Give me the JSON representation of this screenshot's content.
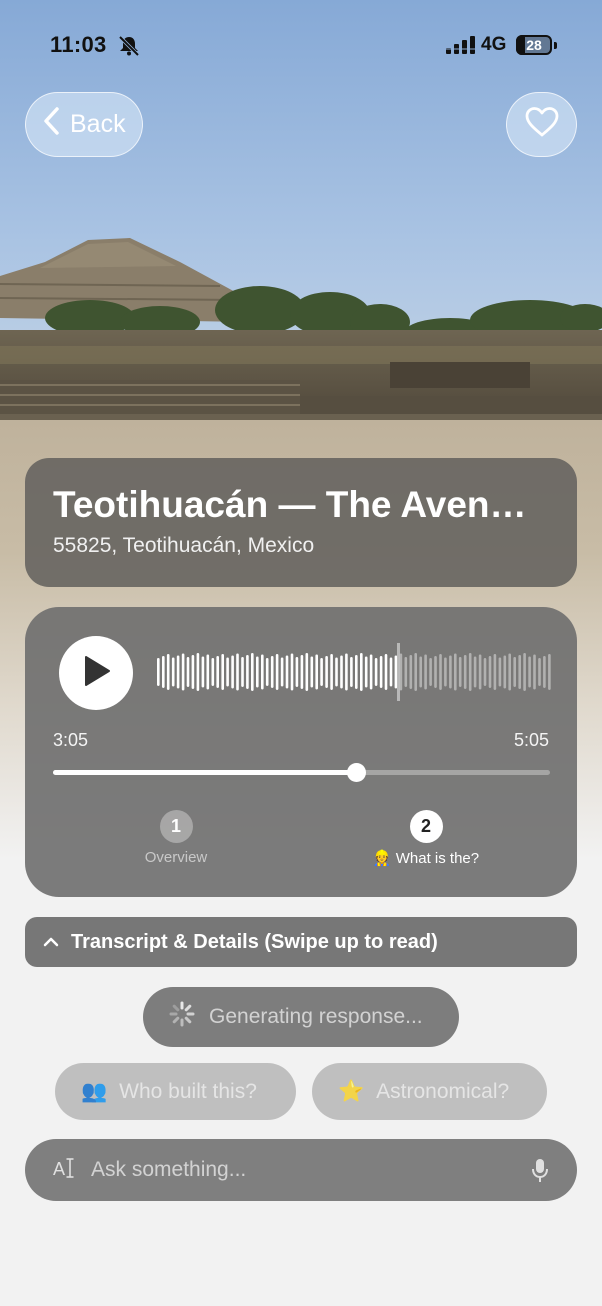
{
  "status_bar": {
    "time": "11:03",
    "network": "4G",
    "battery": "28",
    "icons": [
      "bell-slash-icon",
      "signal-icon",
      "battery-icon"
    ]
  },
  "nav": {
    "back_label": "Back",
    "back_icon": "chevron-left-icon",
    "favorite_icon": "heart-icon"
  },
  "place": {
    "title": "Teotihuacán — The Aven…",
    "address": "55825, Teotihuacán, Mexico"
  },
  "player": {
    "play_icon": "play-icon",
    "current_time": "3:05",
    "total_time": "5:05",
    "progress": 0.61,
    "chapters": [
      {
        "number": "1",
        "label": "Overview",
        "active": false
      },
      {
        "number": "2",
        "emoji": "👷",
        "label": "What is the?",
        "active": true
      }
    ]
  },
  "transcript": {
    "label": "Transcript & Details (Swipe up to read)",
    "icon": "chevron-up-icon"
  },
  "generating": {
    "label": "Generating response...",
    "icon": "spinner-icon"
  },
  "suggestions": [
    {
      "emoji": "👥",
      "label": "Who built this?"
    },
    {
      "emoji": "⭐",
      "label": "Astronomical?"
    }
  ],
  "ask": {
    "placeholder": "Ask something...",
    "icons": [
      "text-cursor-icon",
      "microphone-icon"
    ]
  },
  "colors": {
    "card_gray": "#646260",
    "player_gray": "#6e6e6e",
    "sky_top": "#8fb0d8",
    "background": "#f2f2f2"
  }
}
